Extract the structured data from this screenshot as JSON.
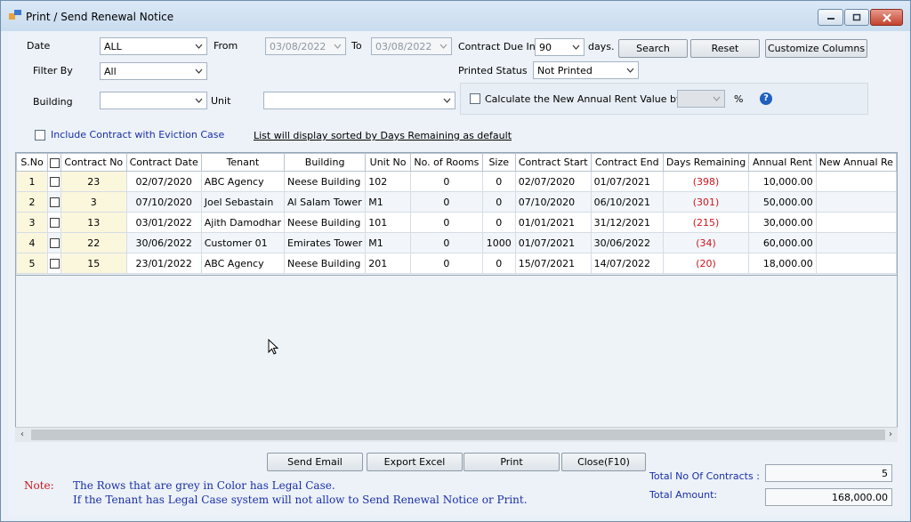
{
  "window": {
    "title": "Print / Send Renewal Notice"
  },
  "filters": {
    "date_label": "Date",
    "date_value": "ALL",
    "from_label": "From",
    "from_value": "03/08/2022",
    "to_label": "To",
    "to_value": "03/08/2022",
    "contract_due_label": "Contract Due In",
    "contract_due_value": "90",
    "days_label": "days.",
    "filter_by_label": "Filter By",
    "filter_by_value": "All",
    "printed_status_label": "Printed Status",
    "printed_status_value": "Not Printed",
    "building_label": "Building",
    "building_value": "",
    "unit_label": "Unit",
    "unit_value": "",
    "calc_label": "Calculate the New Annual Rent Value by",
    "percent_label": "%",
    "eviction_label": "Include Contract with Eviction Case",
    "sorted_note": "List will display sorted by Days Remaining as default"
  },
  "toolbar": {
    "search": "Search",
    "reset": "Reset",
    "customize": "Customize Columns"
  },
  "table": {
    "columns": [
      "S.No",
      "",
      "Contract No",
      "Contract Date",
      "Tenant",
      "Building",
      "Unit No",
      "No. of Rooms",
      "Size",
      "Contract Start",
      "Contract End",
      "Days Remaining",
      "Annual Rent",
      "New Annual Re"
    ],
    "rows": [
      {
        "sno": "1",
        "contract_no": "23",
        "contract_date": "02/07/2020",
        "tenant": "ABC Agency",
        "building": "Neese Building",
        "unit": "102",
        "rooms": "0",
        "size": "0",
        "start": "02/07/2020",
        "end": "01/07/2021",
        "days": "(398)",
        "rent": "10,000.00"
      },
      {
        "sno": "2",
        "contract_no": "3",
        "contract_date": "07/10/2020",
        "tenant": "Joel Sebastain",
        "building": "Al Salam Tower",
        "unit": "M1",
        "rooms": "0",
        "size": "0",
        "start": "07/10/2020",
        "end": "06/10/2021",
        "days": "(301)",
        "rent": "50,000.00"
      },
      {
        "sno": "3",
        "contract_no": "13",
        "contract_date": "03/01/2022",
        "tenant": "Ajith Damodhar",
        "building": "Neese Building",
        "unit": "101",
        "rooms": "0",
        "size": "0",
        "start": "01/01/2021",
        "end": "31/12/2021",
        "days": "(215)",
        "rent": "30,000.00"
      },
      {
        "sno": "4",
        "contract_no": "22",
        "contract_date": "30/06/2022",
        "tenant": "Customer 01",
        "building": "Emirates Tower",
        "unit": "M1",
        "rooms": "0",
        "size": "1000",
        "start": "01/07/2021",
        "end": "30/06/2022",
        "days": "(34)",
        "rent": "60,000.00"
      },
      {
        "sno": "5",
        "contract_no": "15",
        "contract_date": "23/01/2022",
        "tenant": "ABC Agency",
        "building": "Neese Building",
        "unit": "201",
        "rooms": "0",
        "size": "0",
        "start": "15/07/2021",
        "end": "14/07/2022",
        "days": "(20)",
        "rent": "18,000.00"
      }
    ]
  },
  "actions": {
    "send_email": "Send Email",
    "export_excel": "Export Excel",
    "print": "Print",
    "close": "Close(F10)"
  },
  "summary": {
    "total_contracts_label": "Total No Of Contracts :",
    "total_contracts_value": "5",
    "total_amount_label": "Total Amount:",
    "total_amount_value": "168,000.00"
  },
  "note": {
    "label": "Note:",
    "line1": "The Rows that are grey in Color has Legal Case.",
    "line2": "If the Tenant has Legal Case system will not allow to Send Renewal Notice or Print."
  },
  "colors": {
    "days_remaining": "#d0141c",
    "note_blue": "#1a2fa8",
    "note_red": "#d0141c"
  }
}
